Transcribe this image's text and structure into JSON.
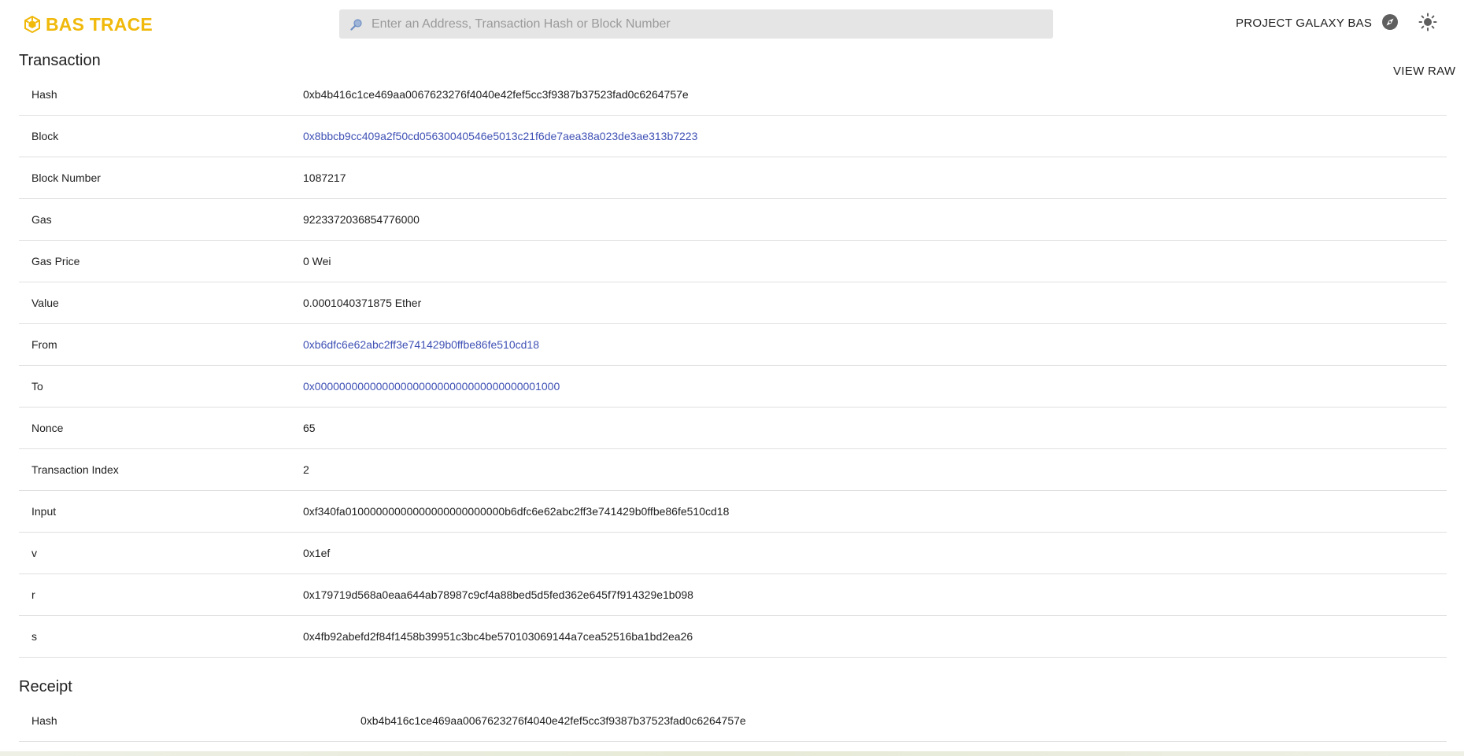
{
  "header": {
    "logo_text": "BAS TRACE",
    "search_placeholder": "Enter an Address, Transaction Hash or Block Number",
    "project_link": "PROJECT GALAXY BAS",
    "brand_color": "#f0b90b"
  },
  "transaction": {
    "title": "Transaction",
    "view_raw": "VIEW RAW",
    "rows": [
      {
        "label": "Hash",
        "value": "0xb4b416c1ce469aa0067623276f4040e42fef5cc3f9387b37523fad0c6264757e"
      },
      {
        "label": "Block",
        "value": "0x8bbcb9cc409a2f50cd05630040546e5013c21f6de7aea38a023de3ae313b7223"
      },
      {
        "label": "Block Number",
        "value": "1087217"
      },
      {
        "label": "Gas",
        "value": "9223372036854776000"
      },
      {
        "label": "Gas Price",
        "value": "0 Wei"
      },
      {
        "label": "Value",
        "value": "0.0001040371875 Ether"
      },
      {
        "label": "From",
        "value": "0xb6dfc6e62abc2ff3e741429b0ffbe86fe510cd18"
      },
      {
        "label": "To",
        "value": "0x0000000000000000000000000000000000001000"
      },
      {
        "label": "Nonce",
        "value": "65"
      },
      {
        "label": "Transaction Index",
        "value": "2"
      },
      {
        "label": "Input",
        "value": "0xf340fa01000000000000000000000000b6dfc6e62abc2ff3e741429b0ffbe86fe510cd18"
      },
      {
        "label": "v",
        "value": "0x1ef"
      },
      {
        "label": "r",
        "value": "0x179719d568a0eaa644ab78987c9cf4a88bed5d5fed362e645f7f914329e1b098"
      },
      {
        "label": "s",
        "value": "0x4fb92abefd2f84f1458b39951c3bc4be570103069144a7cea52516ba1bd2ea26"
      }
    ]
  },
  "receipt": {
    "title": "Receipt",
    "rows": [
      {
        "label": "Hash",
        "value": "0xb4b416c1ce469aa0067623276f4040e42fef5cc3f9387b37523fad0c6264757e"
      }
    ]
  },
  "link_color": "#3f51b5"
}
